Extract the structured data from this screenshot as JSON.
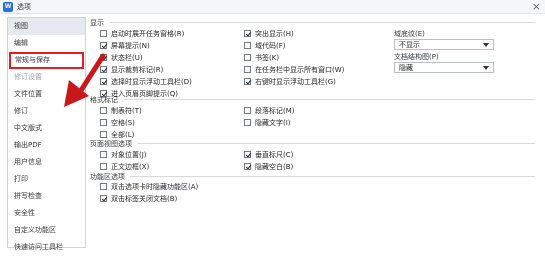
{
  "window": {
    "app_icon_text": "W",
    "title": "选项",
    "close_glyph": "×"
  },
  "sidebar": {
    "items": [
      {
        "label": "视图",
        "state": "selected"
      },
      {
        "label": "编辑",
        "state": "normal"
      },
      {
        "label": "常规与保存",
        "state": "highlighted"
      },
      {
        "label": "修订设置",
        "state": "faded"
      },
      {
        "label": "文件位置",
        "state": "normal"
      },
      {
        "label": "修订",
        "state": "normal"
      },
      {
        "label": "中文版式",
        "state": "normal"
      },
      {
        "label": "输出PDF",
        "state": "normal"
      },
      {
        "label": "用户信息",
        "state": "normal"
      },
      {
        "label": "打印",
        "state": "normal"
      },
      {
        "label": "拼写检查",
        "state": "normal"
      },
      {
        "label": "安全性",
        "state": "normal"
      },
      {
        "label": "自定义功能区",
        "state": "normal"
      },
      {
        "label": "快速访问工具栏",
        "state": "normal"
      }
    ]
  },
  "display": {
    "title": "显示",
    "col1": [
      {
        "label": "启动时展开任务窗格(R)",
        "checked": false
      },
      {
        "label": "屏幕提示(N)",
        "checked": true
      },
      {
        "label": "状态栏(U)",
        "checked": true
      },
      {
        "label": "显示裁剪标记(R)",
        "checked": true
      },
      {
        "label": "选择时显示浮动工具栏(D)",
        "checked": true
      },
      {
        "label": "进入页眉页脚提示(Q)",
        "checked": true
      }
    ],
    "col2": [
      {
        "label": "突出显示(H)",
        "checked": true
      },
      {
        "label": "域代码(F)",
        "checked": false
      },
      {
        "label": "书签(K)",
        "checked": false
      },
      {
        "label": "在任务栏中显示所有窗口(W)",
        "checked": false
      },
      {
        "label": "右键时显示浮动工具栏(G)",
        "checked": true
      }
    ],
    "field_shading_label": "域底纹(E)",
    "field_shading_value": "不显示",
    "doc_map_label": "文档结构图(P)",
    "doc_map_value": "隐藏"
  },
  "format_marks": {
    "title": "格式标记",
    "col1": [
      {
        "label": "制表符(T)",
        "checked": false
      },
      {
        "label": "空格(S)",
        "checked": false
      },
      {
        "label": "全部(L)",
        "checked": false
      }
    ],
    "col2": [
      {
        "label": "段落标记(M)",
        "checked": false
      },
      {
        "label": "隐藏文字(I)",
        "checked": false
      }
    ]
  },
  "page_view": {
    "title": "页面视图选项",
    "col1": [
      {
        "label": "对象位置(J)",
        "checked": false
      },
      {
        "label": "正文边框(X)",
        "checked": false
      }
    ],
    "col2": [
      {
        "label": "垂直标尺(C)",
        "checked": true
      },
      {
        "label": "隐藏空白(B)",
        "checked": true
      }
    ]
  },
  "ribbon": {
    "title": "功能区选项",
    "items": [
      {
        "label": "双击选项卡时隐藏功能区(A)",
        "checked": false
      },
      {
        "label": "双击标签关闭文档(B)",
        "checked": true
      }
    ]
  },
  "colors": {
    "highlight_border": "#e02020",
    "arrow": "#c8181c",
    "selected_bg": "#e6eaf0"
  }
}
